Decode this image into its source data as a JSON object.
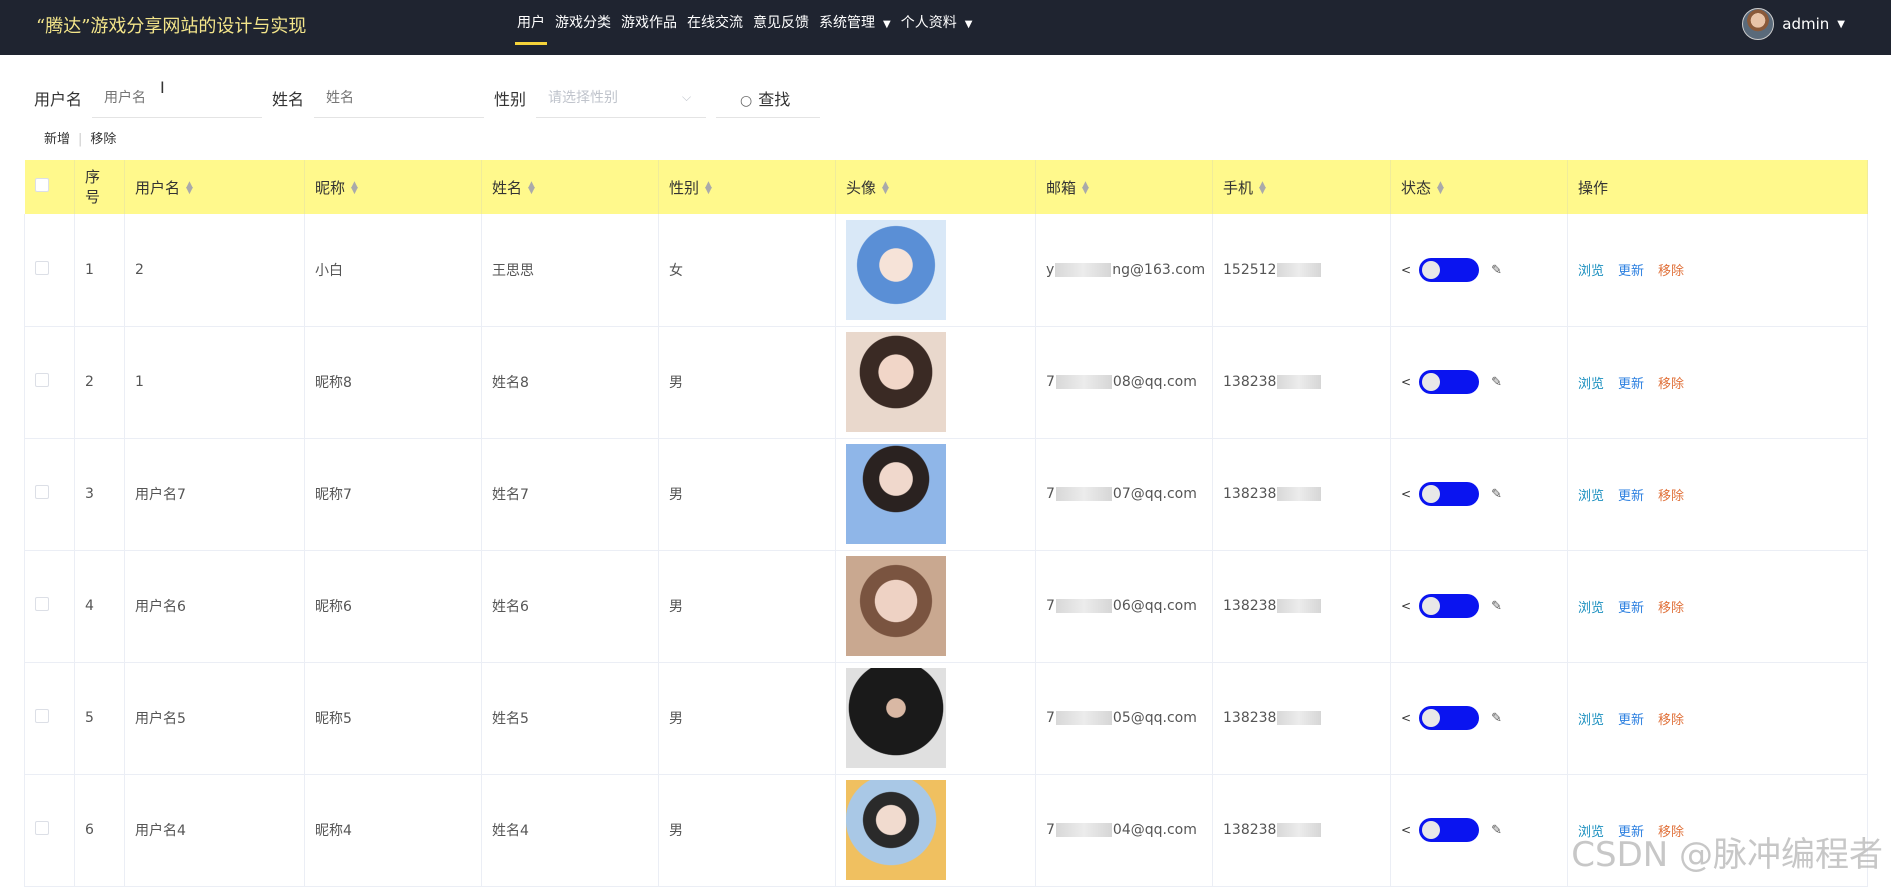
{
  "header": {
    "brand": "“腾达”游戏分享网站的设计与实现",
    "nav": [
      {
        "label": "用户",
        "active": true
      },
      {
        "label": "游戏分类"
      },
      {
        "label": "游戏作品"
      },
      {
        "label": "在线交流"
      },
      {
        "label": "意见反馈"
      },
      {
        "label": "系统管理",
        "dropdown": true
      },
      {
        "label": "个人资料",
        "dropdown": true
      }
    ],
    "user": "admin"
  },
  "search": {
    "username_label": "用户名",
    "username_placeholder": "用户名",
    "name_label": "姓名",
    "name_placeholder": "姓名",
    "gender_label": "性别",
    "gender_placeholder": "请选择性别",
    "button": "查找"
  },
  "actions": {
    "add": "新增",
    "remove": "移除"
  },
  "table": {
    "columns": [
      "序号",
      "用户名",
      "昵称",
      "姓名",
      "性别",
      "头像",
      "邮箱",
      "手机",
      "状态",
      "操作"
    ],
    "op_view": "浏览",
    "op_update": "更新",
    "op_remove": "移除",
    "rows": [
      {
        "no": "1",
        "username": "2",
        "nickname": "小白",
        "name": "王思思",
        "gender": "女",
        "email_prefix": "y",
        "email_suffix": "ng@163.com",
        "phone": "152512",
        "avatar": "blue-hair-anime-girl"
      },
      {
        "no": "2",
        "username": "1",
        "nickname": "昵称8",
        "name": "姓名8",
        "gender": "男",
        "email_prefix": "7",
        "email_suffix": "08@qq.com",
        "phone": "138238",
        "avatar": "girl-portrait"
      },
      {
        "no": "3",
        "username": "用户名7",
        "nickname": "昵称7",
        "name": "姓名7",
        "gender": "男",
        "email_prefix": "7",
        "email_suffix": "07@qq.com",
        "phone": "138238",
        "avatar": "girl-blue-sweater"
      },
      {
        "no": "4",
        "username": "用户名6",
        "nickname": "昵称6",
        "name": "姓名6",
        "gender": "男",
        "email_prefix": "7",
        "email_suffix": "06@qq.com",
        "phone": "138238",
        "avatar": "girl-closeup"
      },
      {
        "no": "5",
        "username": "用户名5",
        "nickname": "昵称5",
        "name": "姓名5",
        "gender": "男",
        "email_prefix": "7",
        "email_suffix": "05@qq.com",
        "phone": "138238",
        "avatar": "man-black-mask"
      },
      {
        "no": "6",
        "username": "用户名4",
        "nickname": "昵称4",
        "name": "姓名4",
        "gender": "男",
        "email_prefix": "7",
        "email_suffix": "04@qq.com",
        "phone": "138238",
        "avatar": "girl-cushion"
      }
    ]
  },
  "watermark": "CSDN @脉冲编程者",
  "colors": {
    "navbar": "#1f2430",
    "brand": "#f3e58a",
    "active_underline": "#f5d33a",
    "table_header": "#fff98c",
    "toggle": "#0a14f0",
    "view": "#1a8fbf",
    "update": "#2b7fe0",
    "remove": "#e0713a"
  }
}
